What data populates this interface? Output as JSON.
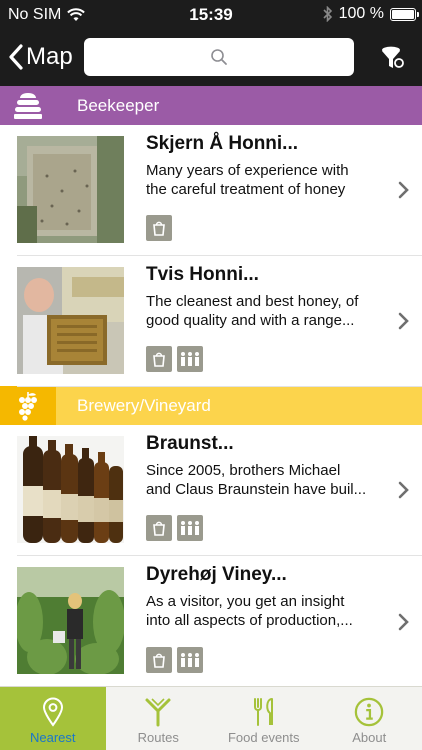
{
  "status_bar": {
    "carrier": "No SIM",
    "time": "15:39",
    "battery": "100 %",
    "battery_level": 1.0
  },
  "nav": {
    "back_label": "Map",
    "search_placeholder": ""
  },
  "colors": {
    "beekeeper": "#9b5ba6",
    "brewery": "#fcd44c",
    "brewery_icon_bg": "#f5b800",
    "active_tab": "#a5c23a",
    "active_tab_text": "#1a77c9",
    "badge": "#9a9a8e"
  },
  "sections": [
    {
      "label": "Beekeeper",
      "icon": "beehive-icon",
      "items": [
        {
          "title": "Skjern Å Honni...",
          "desc1": "Many years of experience with",
          "desc2": "the careful treatment of honey",
          "badges": [
            "shop-icon"
          ]
        },
        {
          "title": "Tvis Honni...",
          "desc1": "The cleanest and best honey, of",
          "desc2": "good quality and with a range...",
          "badges": [
            "shop-icon",
            "group-icon"
          ]
        }
      ]
    },
    {
      "label": "Brewery/Vineyard",
      "icon": "grapes-icon",
      "items": [
        {
          "title": "Braunst...",
          "desc1": "Since 2005, brothers Michael",
          "desc2": "and Claus Braunstein have buil...",
          "badges": [
            "shop-icon",
            "group-icon"
          ]
        },
        {
          "title": "Dyrehøj Viney...",
          "desc1": "As a visitor, you get an insight",
          "desc2": "into all aspects of production,...",
          "badges": [
            "shop-icon",
            "group-icon"
          ]
        }
      ]
    }
  ],
  "tabs": [
    {
      "label": "Nearest",
      "icon": "location-pin-icon",
      "active": true
    },
    {
      "label": "Routes",
      "icon": "routes-icon",
      "active": false
    },
    {
      "label": "Food events",
      "icon": "cutlery-icon",
      "active": false
    },
    {
      "label": "About",
      "icon": "info-icon",
      "active": false
    }
  ]
}
